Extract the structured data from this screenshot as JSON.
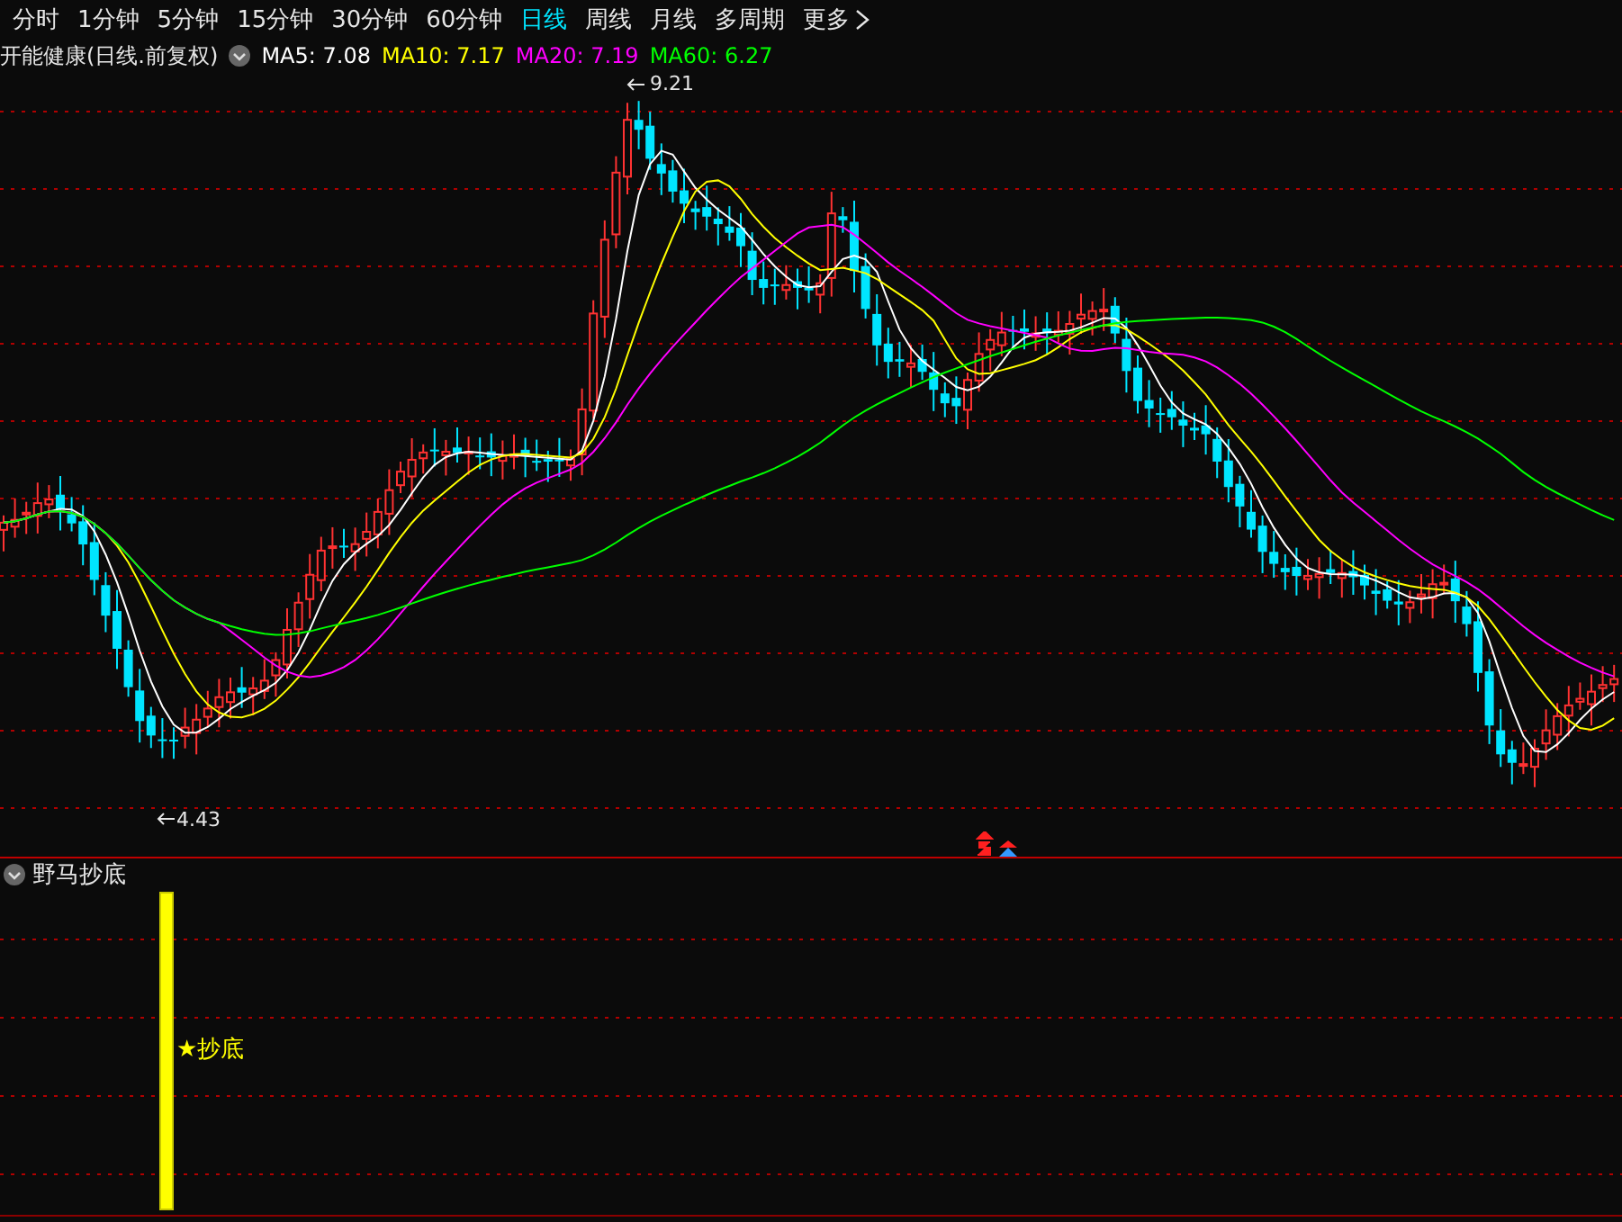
{
  "periods": [
    {
      "label": "分时",
      "selected": false
    },
    {
      "label": "1分钟",
      "selected": false
    },
    {
      "label": "5分钟",
      "selected": false
    },
    {
      "label": "15分钟",
      "selected": false
    },
    {
      "label": "30分钟",
      "selected": false
    },
    {
      "label": "60分钟",
      "selected": false
    },
    {
      "label": "日线",
      "selected": true
    },
    {
      "label": "周线",
      "selected": false
    },
    {
      "label": "月线",
      "selected": false
    },
    {
      "label": "多周期",
      "selected": false
    },
    {
      "label": "更多",
      "selected": false
    }
  ],
  "main_chart": {
    "title": "开能健康(日线.前复权)",
    "moving_averages": [
      {
        "label": "MA5: 7.08",
        "color": "#ffffff"
      },
      {
        "label": "MA10: 7.17",
        "color": "#ffff00"
      },
      {
        "label": "MA20: 7.19",
        "color": "#ff00ff"
      },
      {
        "label": "MA60: 6.27",
        "color": "#00ff00"
      }
    ],
    "high_label": "9.21",
    "low_label": "4.43"
  },
  "indicator_panel": {
    "title": "野马抄底",
    "signal_label": "★抄底"
  }
}
